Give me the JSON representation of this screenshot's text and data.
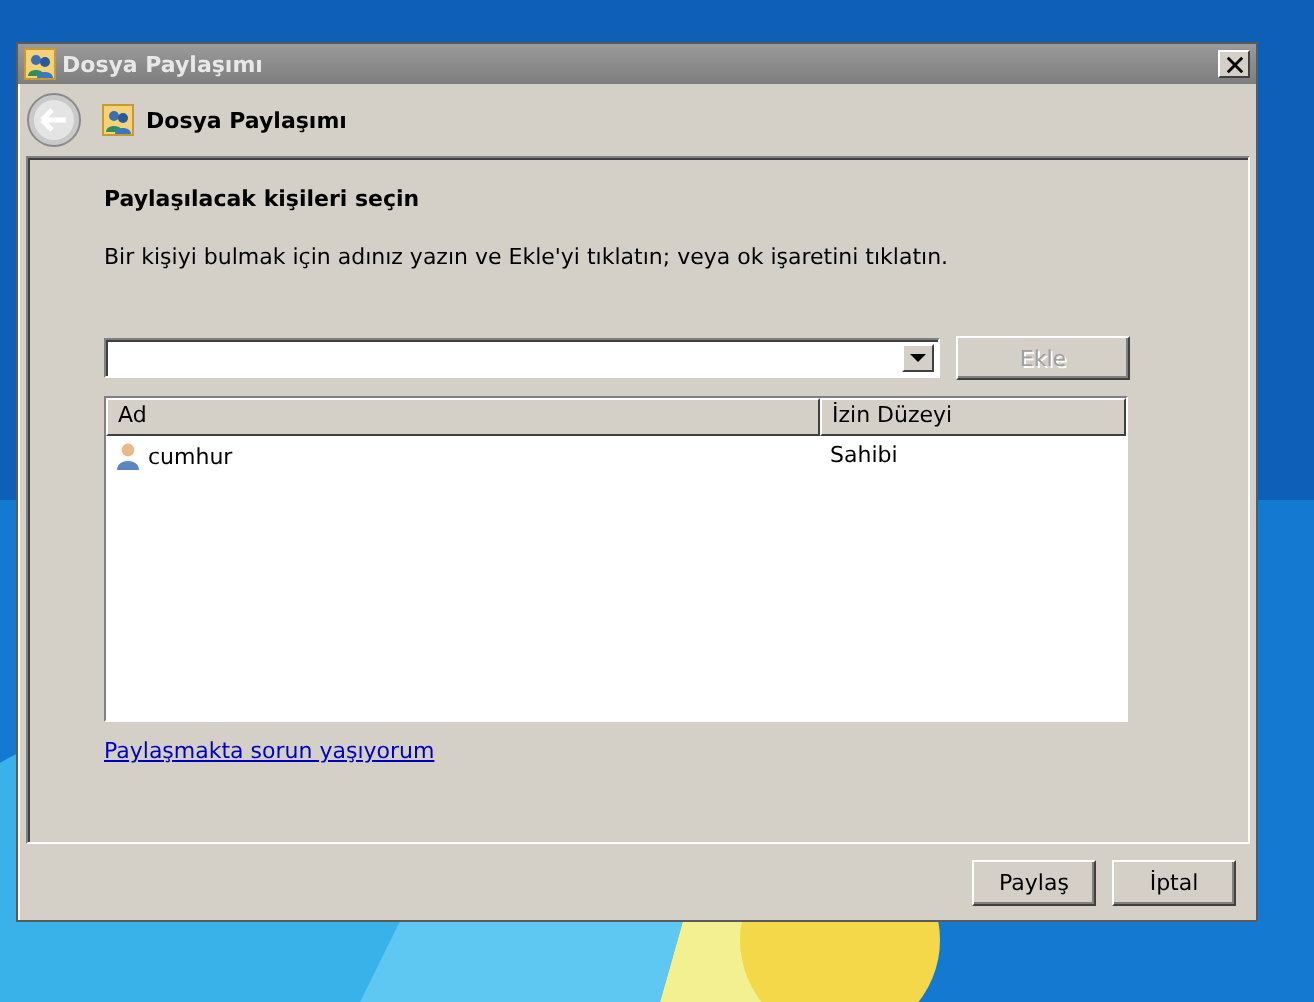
{
  "window": {
    "title": "Dosya Paylaşımı"
  },
  "header": {
    "title": "Dosya Paylaşımı"
  },
  "heading": "Paylaşılacak kişileri seçin",
  "instruction": "Bir kişiyi bulmak için adınız yazın ve Ekle'yi tıklatın; veya ok işaretini tıklatın.",
  "add_button": {
    "label": "Ekle",
    "disabled": true
  },
  "table": {
    "columns": [
      "Ad",
      "İzin Düzeyi"
    ],
    "rows": [
      {
        "name": "cumhur",
        "permission": "Sahibi"
      }
    ]
  },
  "help_link": "Paylaşmakta sorun yaşıyorum",
  "buttons": [
    {
      "label": "Paylaş",
      "disabled": false
    },
    {
      "label": "İptal",
      "disabled": false
    }
  ]
}
